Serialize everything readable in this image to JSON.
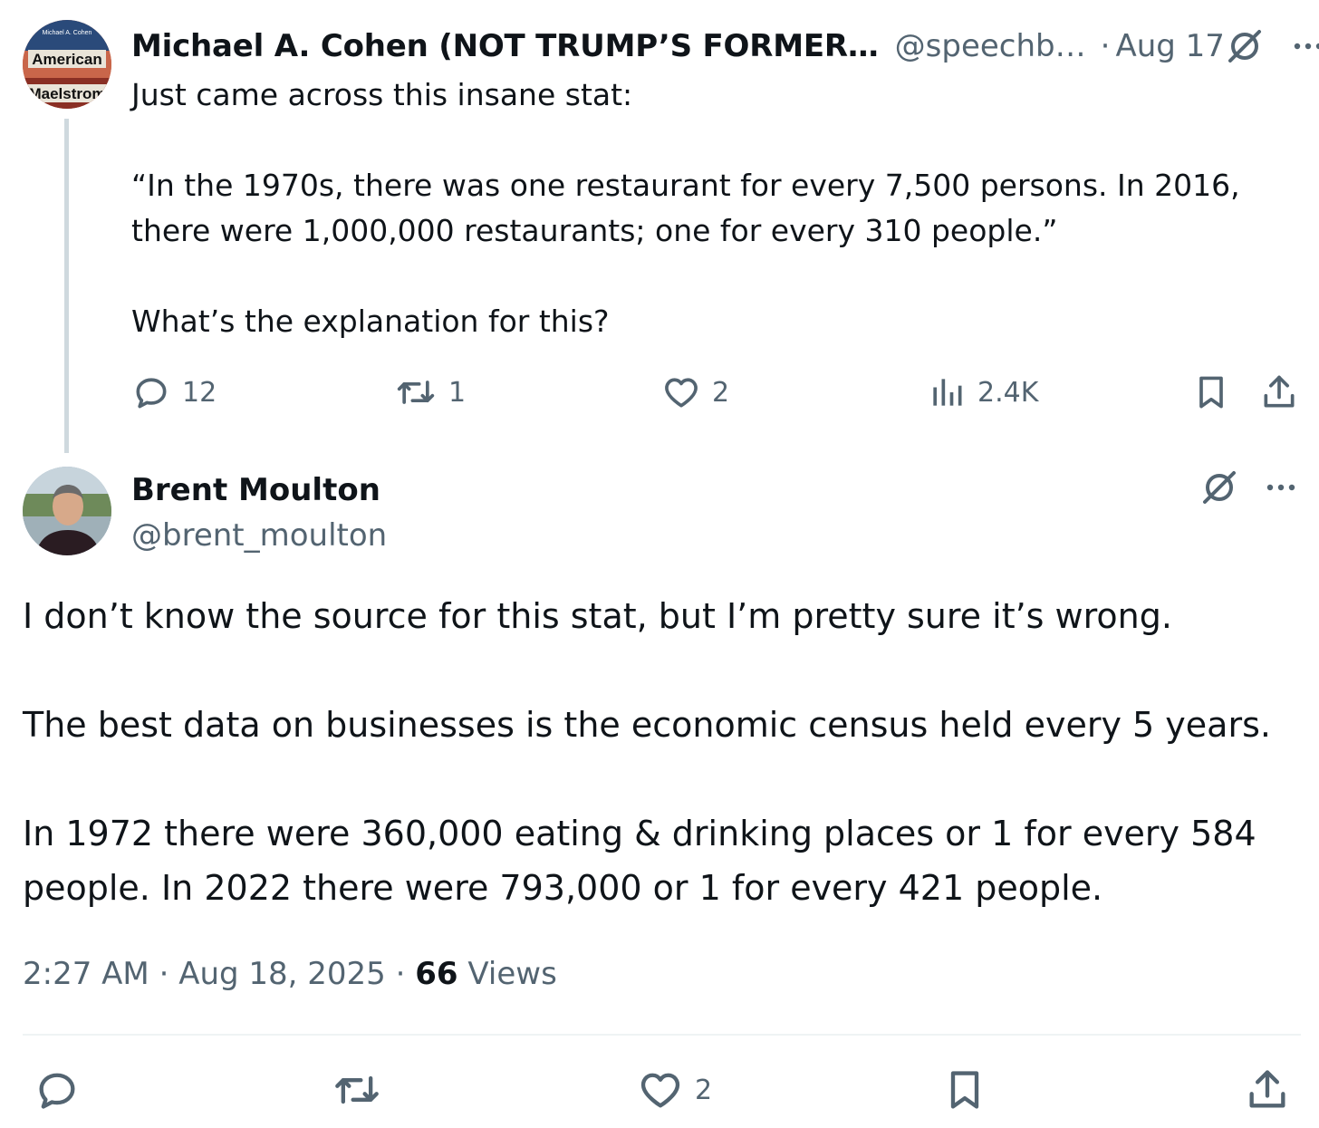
{
  "parent_tweet": {
    "author_name": "Michael A. Cohen (NOT TRUMP’S FORMER…",
    "author_handle": "@speechb…",
    "dot": "·",
    "date": "Aug 17",
    "avatar_text_top": "American",
    "avatar_text_bottom": "Maelstrom",
    "avatar_text_tiny": "Michael A. Cohen",
    "body_lines": [
      "Just came across this insane stat:",
      "“In the 1970s, there was one restaurant for every 7,500 persons. In 2016, there were 1,000,000 restaurants; one for every 310 people.”",
      "What’s the explanation for this?"
    ],
    "metrics": {
      "replies": "12",
      "reposts": "1",
      "likes": "2",
      "views": "2.4K"
    }
  },
  "main_tweet": {
    "author_name": "Brent Moulton",
    "author_handle": "@brent_moulton",
    "body_paragraphs": [
      "I don’t know the source for this stat, but I’m pretty sure it’s wrong.",
      "The best data on businesses is the economic census held every 5 years.",
      "In 1972 there were 360,000 eating & drinking places or 1 for every 584 people. In 2022 there were 793,000 or 1 for every 421 people."
    ],
    "time": "2:27 AM",
    "sep1": "·",
    "date": "Aug 18, 2025",
    "sep2": "·",
    "views_count": "66",
    "views_label": "Views",
    "metrics": {
      "likes": "2"
    }
  },
  "colors": {
    "text": "#0f1419",
    "muted": "#536471",
    "thread_line": "#cfd9de",
    "divider": "#eff3f4"
  },
  "icons": [
    "grok-slash-icon",
    "more-dots-icon",
    "reply-icon",
    "repost-icon",
    "like-icon",
    "views-icon",
    "bookmark-icon",
    "share-icon"
  ]
}
